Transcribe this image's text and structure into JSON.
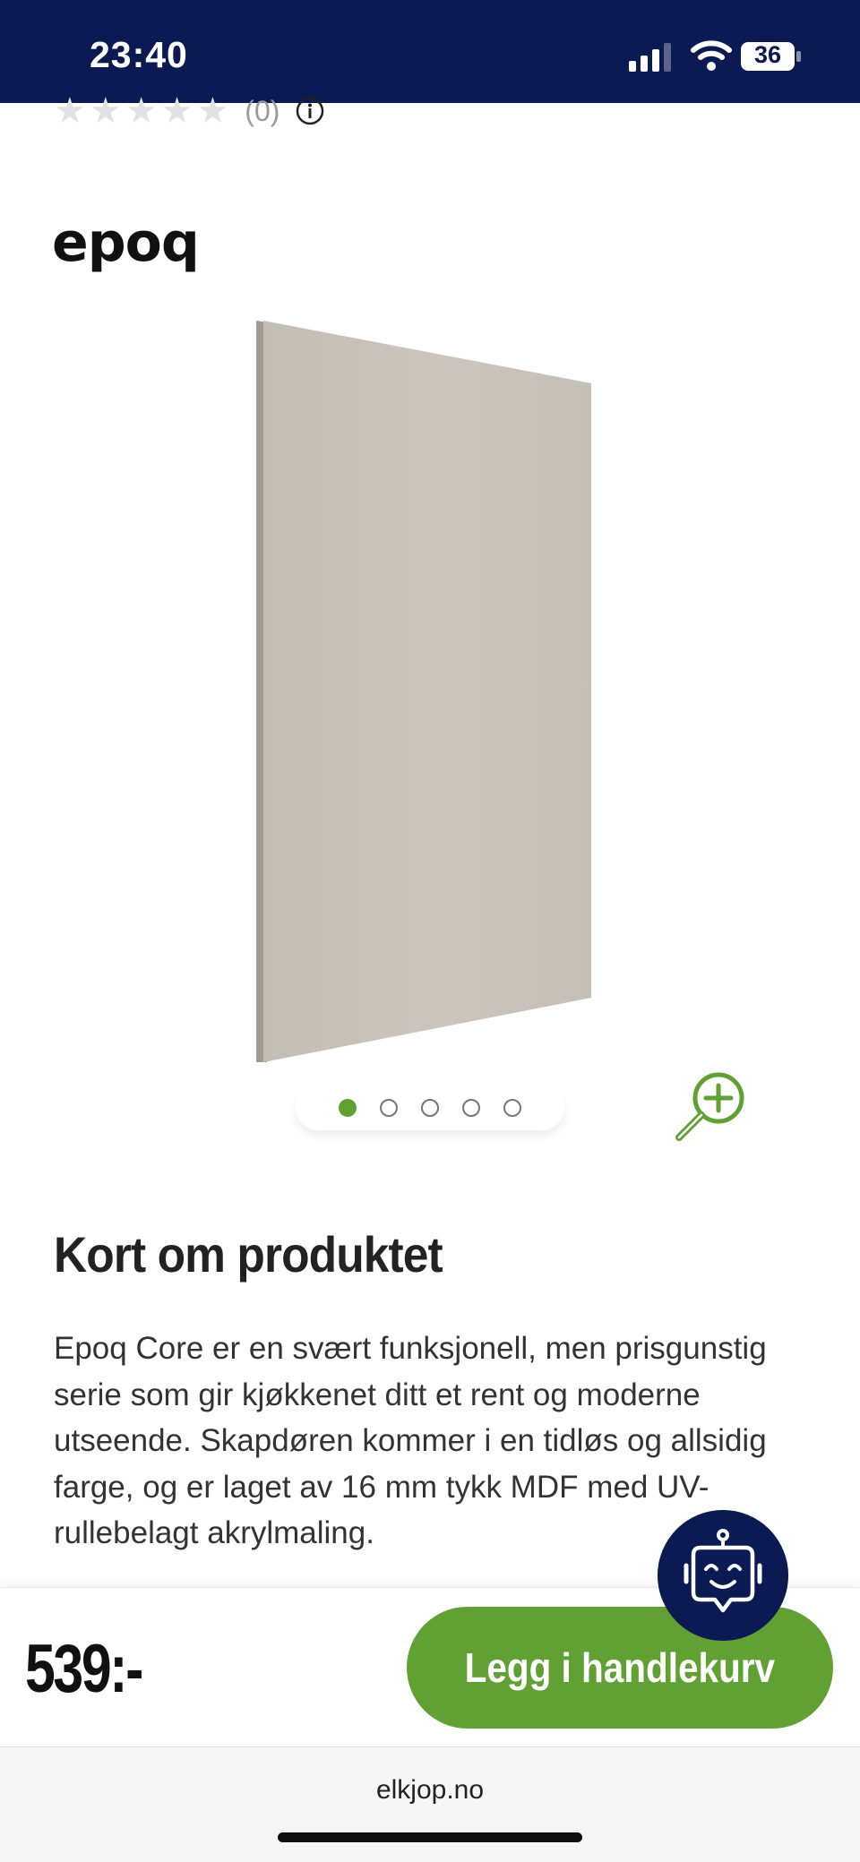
{
  "status_bar": {
    "time": "23:40",
    "battery": "36"
  },
  "rating": {
    "stars": 0,
    "count_text": "(0)"
  },
  "brand": {
    "logo_text": "epoq"
  },
  "product": {
    "color": "#c8c1b9",
    "edge_color": "#a19a91"
  },
  "carousel": {
    "slide_count": 5,
    "active_index": 0
  },
  "section": {
    "title": "Kort om produktet",
    "description": "Epoq Core er en svært funksjonell, men prisgunstig serie som gir kjøkkenet ditt et rent og moderne utseende. Skapdøren kommer i en tidløs og allsidig farge, og er laget av 16 mm tykk MDF med UV-rullebelagt akrylmaling."
  },
  "buy_bar": {
    "price": "539:-",
    "button_label": "Legg i handlekurv"
  },
  "browser": {
    "url": "elkjop.no"
  },
  "colors": {
    "brand_navy": "#0b1a52",
    "accent_green": "#61a032"
  }
}
